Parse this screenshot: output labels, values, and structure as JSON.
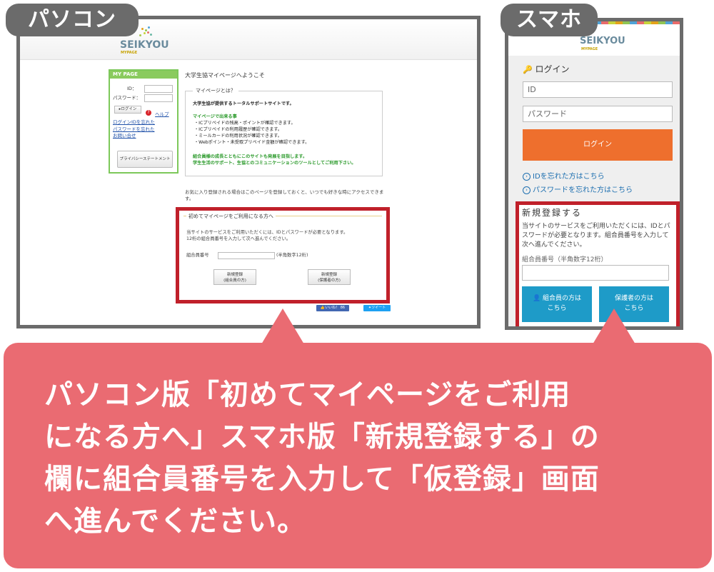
{
  "labels": {
    "pc": "パソコン",
    "sp": "スマホ"
  },
  "logo": {
    "main": "SEIKYOU",
    "sub": "MYPAGE"
  },
  "pc": {
    "sidebar": {
      "header": "MY PAGE",
      "id_label": "ID：",
      "password_label": "パスワード：",
      "login_button": "ログイン",
      "help_link": "ヘルプ",
      "links": [
        "ログインIDを忘れた",
        "パスワードを忘れた",
        "お問い合せ"
      ],
      "privacy_button": "プライバシーステートメント"
    },
    "welcome_title": "大学生協マイページへようこそ",
    "what_box": {
      "legend": "マイページとは？",
      "intro": "大学生協が提供するトータルサポートサイトです。",
      "can_do_title": "マイページで出来る事",
      "items": [
        "・ICプリペイドの残高・ポイントが確認できます。",
        "・ICプリペイドの利用履歴が確認できます。",
        "・ミールカードの利用状況が確認できます。",
        "・Webポイント・未受取プリペイド金額が確認できます。"
      ],
      "closing": [
        "組合員様の成長とともにこのサイトも発展を目指します。",
        "学生生活のサポート、生協とのコミュニケーションのツールとしてご利用下さい。"
      ]
    },
    "bookmark_note": "お気に入り登録される場合はこのページを登録しておくと、いつでも好きな時にアクセスできます。",
    "first_time_box": {
      "legend": "初めてマイページをご利用になる方へ",
      "text": [
        "当サイトのサービスをご利用いただくには、IDとパスワードが必要となります。",
        "12桁の組合員番号を入力して次へ進んでください。"
      ],
      "member_no_label": "組合員番号",
      "member_no_hint": "(半角数字12桁)",
      "btn_member": [
        "新規登録",
        "(組合員の方)"
      ],
      "btn_guardian": [
        "新規登録",
        "(保護者の方)"
      ]
    },
    "social": {
      "like": "いいね！ 86",
      "tweet": "ツイート"
    }
  },
  "sp": {
    "login_title": "ログイン",
    "id_placeholder": "ID",
    "password_placeholder": "パスワード",
    "login_button": "ログイン",
    "forgot_id": "IDを忘れた方はこちら",
    "forgot_password": "パスワードを忘れた方はこちら",
    "register": {
      "title": "新規登録する",
      "text": [
        "当サイトのサービスをご利用いただくには、IDとパ",
        "スワードが必要となります。組合員番号を入力して",
        "次へ進んでください。"
      ],
      "member_no_label": "組合員番号（半角数字12桁）",
      "btn_member": [
        "組合員の方は",
        "こちら"
      ],
      "btn_guardian": [
        "保護者の方は",
        "こちら"
      ]
    }
  },
  "callout": {
    "lines": [
      "パソコン版「初めてマイページをご利用",
      "になる方へ」スマホ版「新規登録する」の",
      "欄に組合員番号を入力して「仮登録」画面",
      "へ進んでください。"
    ]
  },
  "colors": {
    "tab": "#6b6b6b",
    "highlight": "#c0202a",
    "callout": "#ea6b72",
    "green": "#7dc85a",
    "orange": "#ee6f2d",
    "teal": "#1e9bc8"
  }
}
